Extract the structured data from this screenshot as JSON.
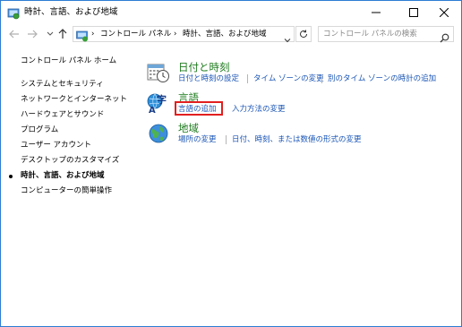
{
  "window": {
    "title": "時計、言語、および地域"
  },
  "address": {
    "breadcrumb": [
      "コントロール パネル",
      "時計、言語、および地域"
    ]
  },
  "search": {
    "placeholder": "コントロール パネルの検索"
  },
  "sidebar": {
    "home": "コントロール パネル ホーム",
    "items": [
      {
        "label": "システムとセキュリティ"
      },
      {
        "label": "ネットワークとインターネット"
      },
      {
        "label": "ハードウェアとサウンド"
      },
      {
        "label": "プログラム"
      },
      {
        "label": "ユーザー アカウント"
      },
      {
        "label": "デスクトップのカスタマイズ"
      },
      {
        "label": "時計、言語、および地域",
        "current": true
      },
      {
        "label": "コンピューターの簡単操作"
      }
    ]
  },
  "categories": [
    {
      "title": "日付と時刻",
      "icon": "calendar-clock-icon",
      "links": [
        "日付と時刻の設定",
        "タイム ゾーンの変更",
        "別のタイム ゾーンの時計の追加"
      ]
    },
    {
      "title": "言語",
      "icon": "language-icon",
      "links": [
        "言語の追加",
        "入力方法の変更"
      ]
    },
    {
      "title": "地域",
      "icon": "globe-icon",
      "links": [
        "場所の変更",
        "日付、時刻、または数値の形式の変更"
      ]
    }
  ],
  "colors": {
    "category_title": "#1e7b1e",
    "link": "#1a55b5",
    "highlight": "#e21f1f",
    "window_border": "#2b7cd3"
  }
}
